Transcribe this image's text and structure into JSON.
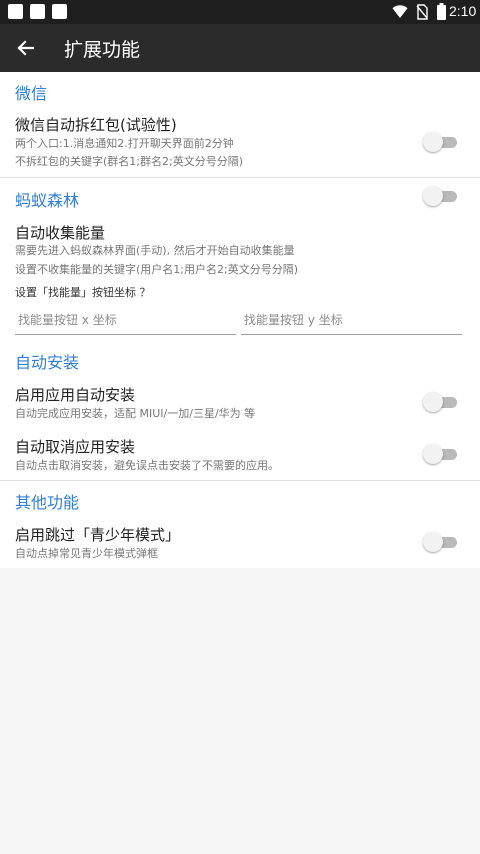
{
  "status_bar": {
    "time": "2:10",
    "notification_icons": [
      "notification-icon",
      "notification-icon",
      "notification-icon"
    ],
    "wifi_icon": "wifi-icon",
    "sim_icon": "no-sim-icon",
    "battery_icon": "battery-icon"
  },
  "toolbar": {
    "back_icon": "arrow-back-icon",
    "title": "扩展功能"
  },
  "sections": {
    "wechat": {
      "title": "微信",
      "pref1": {
        "title": "微信自动拆红包(试验性)",
        "summary_line1": "两个入口:1.消息通知2.打开聊天界面前2分钟",
        "summary_line2": "不拆红包的关键字(群名1;群名2;英文分号分隔)",
        "enabled": false
      }
    },
    "ant_forest": {
      "title": "蚂蚁森林",
      "enabled": false,
      "pref1": {
        "title": "自动收集能量",
        "summary_line1": "需要先进入蚂蚁森林界面(手动), 然后才开始自动收集能量",
        "summary_line2": "设置不收集能量的关键字(用户名1;用户名2;英文分号分隔)"
      },
      "coord_link": "设置「找能量」按钮坐标 ？",
      "x_placeholder": "找能量按钮 x 坐标",
      "y_placeholder": "找能量按钮 y 坐标",
      "x_value": "",
      "y_value": ""
    },
    "auto_install": {
      "title": "自动安装",
      "pref1": {
        "title": "启用应用自动安装",
        "summary": "自动完成应用安装，适配 MIUI/一加/三星/华为 等",
        "enabled": false
      },
      "pref2": {
        "title": "自动取消应用安装",
        "summary": "自动点击取消安装，避免误点击安装了不需要的应用。",
        "enabled": false
      }
    },
    "other": {
      "title": "其他功能",
      "pref1": {
        "title": "启用跳过「青少年模式」",
        "summary": "自动点掉常见青少年模式弹框",
        "enabled": false
      }
    }
  },
  "colors": {
    "accent": "#2f7fd8",
    "toolbar": "#2b2b2b",
    "status_bar": "#1f1f1f",
    "switch_track": "#b9b9b9",
    "switch_thumb": "#f2f2f2"
  }
}
